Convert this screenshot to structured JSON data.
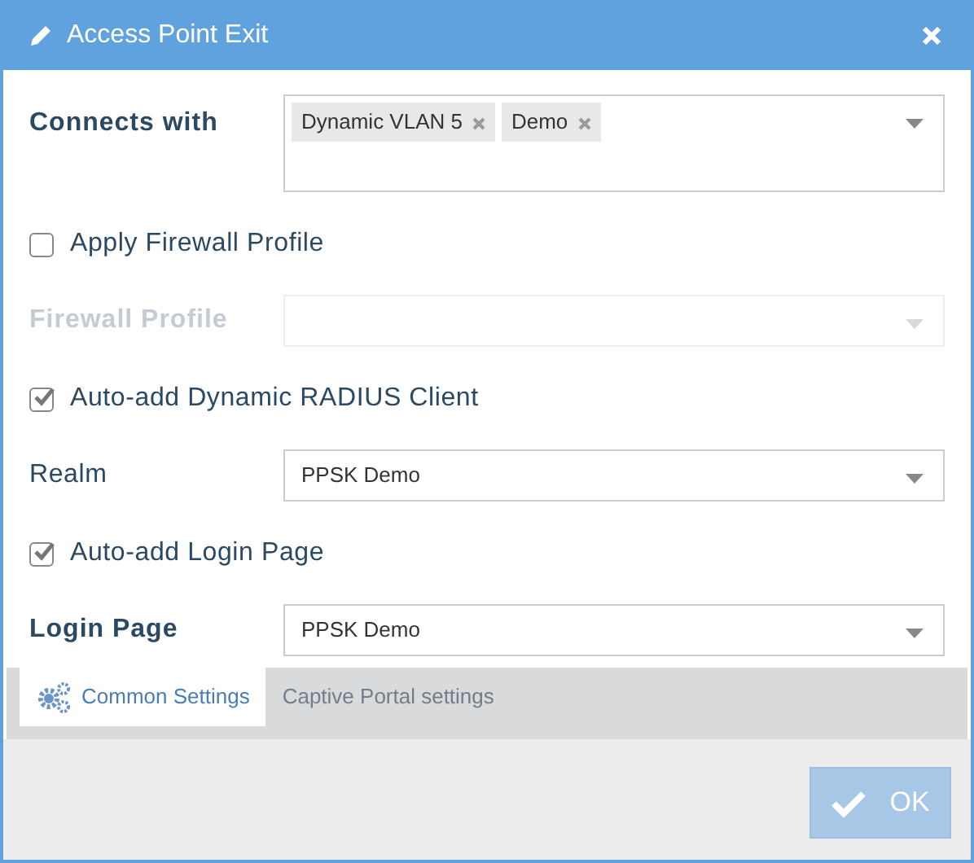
{
  "window": {
    "title": "Access Point Exit"
  },
  "rows": [
    {
      "kind": "multiselect",
      "label": "Connects with",
      "bold": true,
      "disabled": false,
      "tags": [
        "Dynamic VLAN 5",
        "Demo"
      ]
    },
    {
      "kind": "checkbox",
      "label": "Apply Firewall Profile",
      "checked": false
    },
    {
      "kind": "select",
      "label": "Firewall Profile",
      "bold": true,
      "disabled": true
    },
    {
      "kind": "checkbox",
      "label": "Auto-add Dynamic RADIUS Client",
      "checked": true
    },
    {
      "kind": "select",
      "label": "Realm",
      "bold": false,
      "disabled": false,
      "value": "PPSK Demo"
    },
    {
      "kind": "checkbox",
      "label": "Auto-add Login Page",
      "checked": true
    },
    {
      "kind": "select",
      "label": "Login Page",
      "bold": true,
      "disabled": false,
      "value": "PPSK Demo"
    }
  ],
  "tabs": [
    {
      "label": "Common Settings",
      "selected": true
    },
    {
      "label": "Captive Portal settings",
      "selected": false
    }
  ],
  "ok_button": {
    "label": "OK",
    "disabled": true
  }
}
